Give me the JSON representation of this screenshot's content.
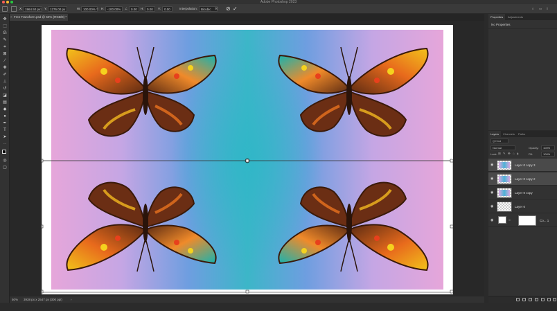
{
  "window": {
    "title": "Adobe Photoshop 2023"
  },
  "options_bar": {
    "x_label": "X:",
    "x_value": "1964.50 px",
    "y_label": "Y:",
    "y_value": "1276.00 px",
    "w_label": "W:",
    "w_value": "100.00%",
    "h_label": "H:",
    "h_value": "-100.00%",
    "angle_value": "0.00",
    "h_skew_label": "H:",
    "h_skew_value": "0.00",
    "v_skew_label": "V:",
    "v_skew_value": "0.00",
    "interpolation_label": "Interpolation:",
    "interpolation_value": "Bicubic",
    "commit_icon": "check-icon",
    "cancel_icon": "cancel-icon"
  },
  "document": {
    "tab_label": "Free Transform.psd @ 50% (RGB/8) *",
    "close_glyph": "×"
  },
  "status_bar": {
    "zoom": "50%",
    "doc_info": "3938 px x 2547 px (300 ppi)",
    "arrow": "›"
  },
  "properties_panel": {
    "tabs": [
      "Properties",
      "Adjustments"
    ],
    "message": "No Properties"
  },
  "layers_panel": {
    "tabs": [
      "Layers",
      "Channels",
      "Paths"
    ],
    "kind_label": "Q Kind",
    "blend_mode": "Normal",
    "opacity_label": "Opacity:",
    "opacity_value": "100%",
    "lock_label": "Lock:",
    "fill_label": "Fill:",
    "fill_value": "100%",
    "layers": [
      {
        "name": "Layer 0 copy 3",
        "selected": true
      },
      {
        "name": "Layer 0 copy 2",
        "selected": true
      },
      {
        "name": "Layer 0 copy",
        "selected": false
      },
      {
        "name": "Layer 0",
        "selected": false
      },
      {
        "name": "Co... 1",
        "selected": false
      }
    ]
  },
  "colors": {
    "canvas_pink": "#e7a2d6",
    "canvas_blue": "#6ea3dd",
    "canvas_teal": "#3fb6c9",
    "selected_layer": "#4a4a4a"
  }
}
